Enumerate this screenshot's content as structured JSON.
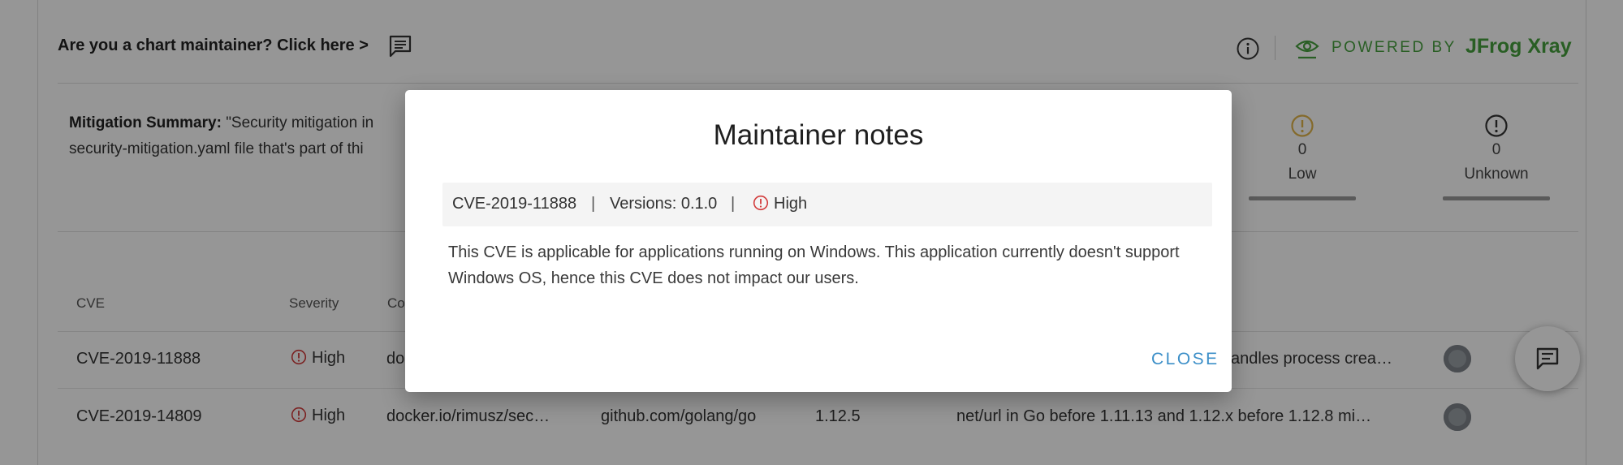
{
  "header": {
    "maintainer_link": "Are you a chart maintainer? Click here >",
    "powered_by": "POWERED BY",
    "brand": "JFrog Xray",
    "icons": [
      "comment-icon",
      "info-icon",
      "eye-icon"
    ]
  },
  "mitigation": {
    "label": "Mitigation Summary:",
    "line1": "\"Security mitigation in",
    "line2": "security-mitigation.yaml file that's part of thi"
  },
  "severity_summary": [
    {
      "count": "0",
      "label": "Low",
      "color": "#e0b44a"
    },
    {
      "count": "0",
      "label": "Unknown",
      "color": "#333333"
    }
  ],
  "table": {
    "headers": [
      "CVE",
      "Severity",
      "Co"
    ],
    "rows": [
      {
        "cve": "CVE-2019-11888",
        "severity": "High",
        "component": "do",
        "description": "andles process crea…"
      },
      {
        "cve": "CVE-2019-14809",
        "severity": "High",
        "component": "docker.io/rimusz/sec…",
        "package": "github.com/golang/go",
        "version": "1.12.5",
        "description": "net/url in Go before 1.11.13 and 1.12.x before 1.12.8 mi…"
      }
    ]
  },
  "modal": {
    "title": "Maintainer notes",
    "cve": "CVE-2019-11888",
    "separator": "|",
    "versions": "Versions: 0.1.0",
    "severity": "High",
    "note": "This CVE is applicable for applications running on Windows. This application currently doesn't support Windows OS, hence this CVE does not impact our users.",
    "close_label": "CLOSE"
  },
  "colors": {
    "brand_green": "#46a13e",
    "high_red": "#d23a3a",
    "link_blue": "#3c8fc8",
    "overlay": "rgba(0,0,0,0.41)"
  }
}
